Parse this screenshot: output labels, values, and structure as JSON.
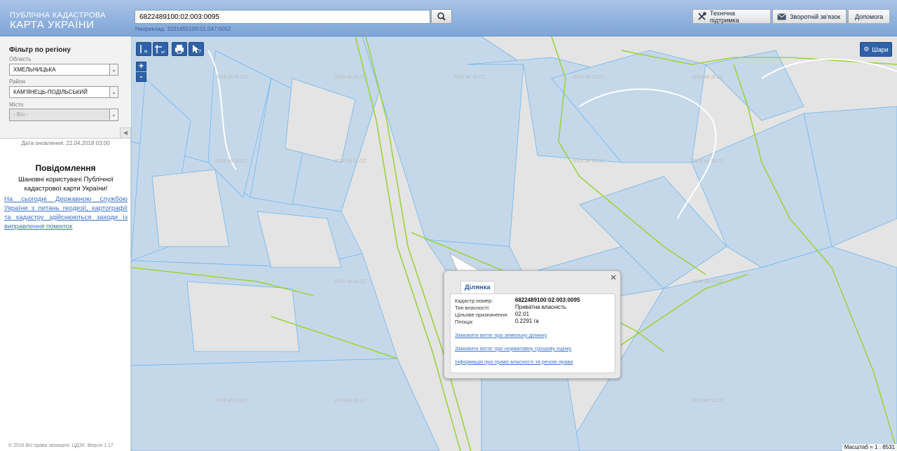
{
  "header": {
    "logo_top": "ПУБЛІЧНА КАДАСТРОВА",
    "logo_main": "КАРТА УКРАЇНИ",
    "search_value": "6822489100:02:003:0095",
    "search_hint": "Наприклад: 3221655100:01:047:0052",
    "support_label": "Технічна підтримка",
    "feedback_label": "Зворотній зв'язок",
    "help_label": "Допомога"
  },
  "sidebar": {
    "filter_title": "Фільтр по регіону",
    "oblast_label": "Область",
    "oblast_value": "ХМЕЛЬНИЦЬКА",
    "rayon_label": "Район",
    "rayon_value": "КАМ'ЯНЕЦЬ-ПОДІЛЬСЬКИЙ",
    "city_label": "Місто",
    "city_value": "- Всі -",
    "update_date": "Дата оновлення: 22.04.2018 03:00",
    "notice_title": "Повідомлення",
    "notice_body": "Шановні користувачі Публічної кадастрової карти України!",
    "notice_link": "На сьогодні Державною службою України з питань геодезії, картографії та кадастру здійснюються заходи із виправлення помилок",
    "copyright": "© 2016 Всі права захищені. ЦДЗК. Версія 1.17."
  },
  "map": {
    "layers_label": "Шари",
    "scale_label": "Масштаб = 1 : 8531",
    "tools": [
      "ruler-line",
      "ruler-area",
      "print",
      "identify"
    ],
    "zoom_in": "+",
    "zoom_out": "-",
    "watermark": "2018 ab SLCC"
  },
  "popup": {
    "tab_label": "Ділянка",
    "rows": [
      {
        "label": "Кадастр.номер:",
        "value": "6822489100:02:003:0095"
      },
      {
        "label": "Тип власності:",
        "value": "Приватна власність"
      },
      {
        "label": "Цільове призначення:",
        "value": "02.01"
      },
      {
        "label": "Площа:",
        "value": "0.2291 га"
      }
    ],
    "links": [
      "Замовити витяг про земельну ділянку",
      "Замовити витяг про нормативну грошову оцінку",
      "Інформація про право власності та речові права"
    ]
  },
  "colors": {
    "parcel_fill": "#c5d8ea",
    "parcel_line": "#6fb6ec",
    "boundary_line": "#9ad33f",
    "accent": "#2f62a8"
  }
}
